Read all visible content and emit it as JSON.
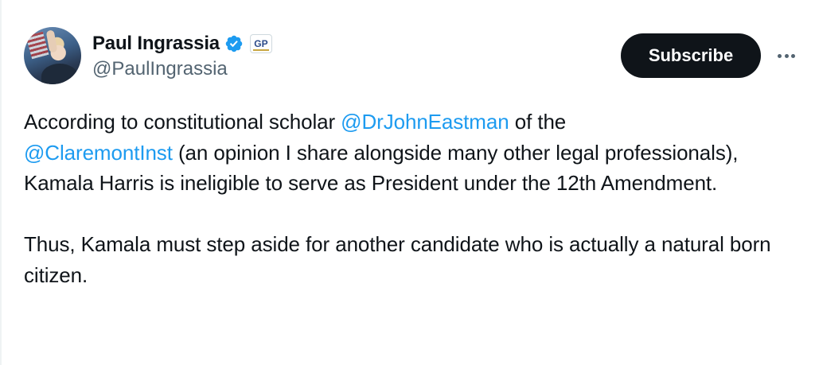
{
  "author": {
    "name": "Paul Ingrassia",
    "handle": "@PaulIngrassia",
    "verified_icon": "verified-badge-icon",
    "affiliation_badge": "GP",
    "colors": {
      "verified": "#1d9bf0",
      "name": "#0f1419",
      "handle": "#536471"
    }
  },
  "actions": {
    "subscribe_label": "Subscribe",
    "more_icon": "more-horizontal-icon"
  },
  "tweet": {
    "para1": {
      "t1": "According to constitutional scholar ",
      "mention1": "@DrJohnEastman",
      "t2": " of the ",
      "mention2": "@ClaremontInst",
      "t3": " (an opinion I share alongside many other legal professionals), Kamala Harris is ineligible to serve as President under the 12th Amendment."
    },
    "para2": "Thus, Kamala must step aside for another candidate who is actually a natural born citizen.",
    "colors": {
      "text": "#0f1419",
      "mention": "#1d9bf0"
    }
  }
}
